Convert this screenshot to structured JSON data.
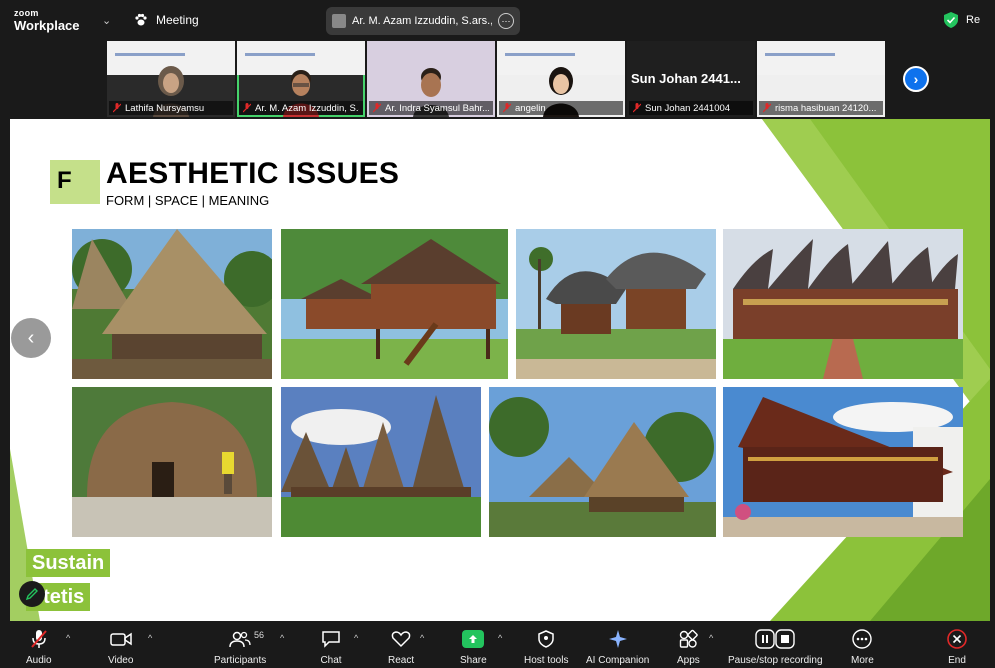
{
  "app": {
    "logo_line1": "zoom",
    "logo_line2": "Workplace",
    "meeting_label": "Meeting",
    "active_speaker": "Ar. M. Azam Izzuddin, S.ars., IAI's",
    "recording_label": "Re"
  },
  "gallery": {
    "tiles": [
      {
        "name": "Lathifa Nursyamsu",
        "muted": true,
        "active": false,
        "bigname": ""
      },
      {
        "name": "Ar. M. Azam Izzuddin, S.ar...",
        "muted": true,
        "active": true,
        "bigname": ""
      },
      {
        "name": "Ar. Indra Syamsul Bahr...",
        "muted": true,
        "active": false,
        "bigname": ""
      },
      {
        "name": "angelin",
        "muted": true,
        "active": false,
        "bigname": ""
      },
      {
        "name": "Sun Johan 2441004",
        "muted": true,
        "active": false,
        "bigname": "Sun Johan 2441..."
      },
      {
        "name": "risma hasibuan 24120...",
        "muted": true,
        "active": false,
        "bigname": ""
      }
    ]
  },
  "slide": {
    "letter": "F",
    "title": "AESTHETIC ISSUES",
    "subtitle": "FORM | SPACE | MEANING",
    "label1": "Sustain",
    "label2": "stetis",
    "accent": "#8cc23a",
    "accent_light": "#c5e08a"
  },
  "toolbar": {
    "audio": "Audio",
    "video": "Video",
    "participants": "Participants",
    "participants_count": "56",
    "chat": "Chat",
    "react": "React",
    "share": "Share",
    "host_tools": "Host tools",
    "ai_companion": "AI Companion",
    "apps": "Apps",
    "recording": "Pause/stop recording",
    "more": "More",
    "end": "End"
  },
  "colors": {
    "zoom_blue": "#0e72ed",
    "active_green": "#46d36b",
    "share_green": "#23c45e",
    "end_red": "#e02828"
  }
}
